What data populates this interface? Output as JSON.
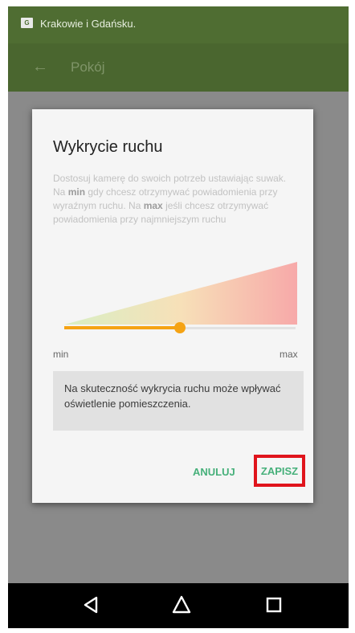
{
  "status_bar": {
    "notification_text": "Krakowie i Gdańsku."
  },
  "app_bar": {
    "title": "Pokój"
  },
  "dialog": {
    "title": "Wykrycie ruchu",
    "description": {
      "part1": "Dostosuj kamerę do swoich potrzeb ustawiając suwak. Na ",
      "bold_min": "min",
      "part2": " gdy chcesz otrzymywać powiadomienia przy wyraźnym ruchu. Na ",
      "bold_max": "max",
      "part3": " jeśli chcesz otrzymywać powiadomienia przy najmniejszym ruchu"
    },
    "slider": {
      "min_label": "min",
      "max_label": "max",
      "value": 0.5
    },
    "info_text": "Na skuteczność wykrycia ruchu może wpływać oświetlenie pomieszczenia.",
    "buttons": {
      "cancel": "ANULUJ",
      "save": "ZAPISZ"
    }
  },
  "colors": {
    "accent": "#f5a314",
    "button_text": "#46b07a",
    "highlight_border": "#e0141c",
    "app_bar": "#4a662f"
  },
  "icons": [
    "back-arrow-icon",
    "nav-back-icon",
    "nav-home-icon",
    "nav-recent-icon"
  ]
}
